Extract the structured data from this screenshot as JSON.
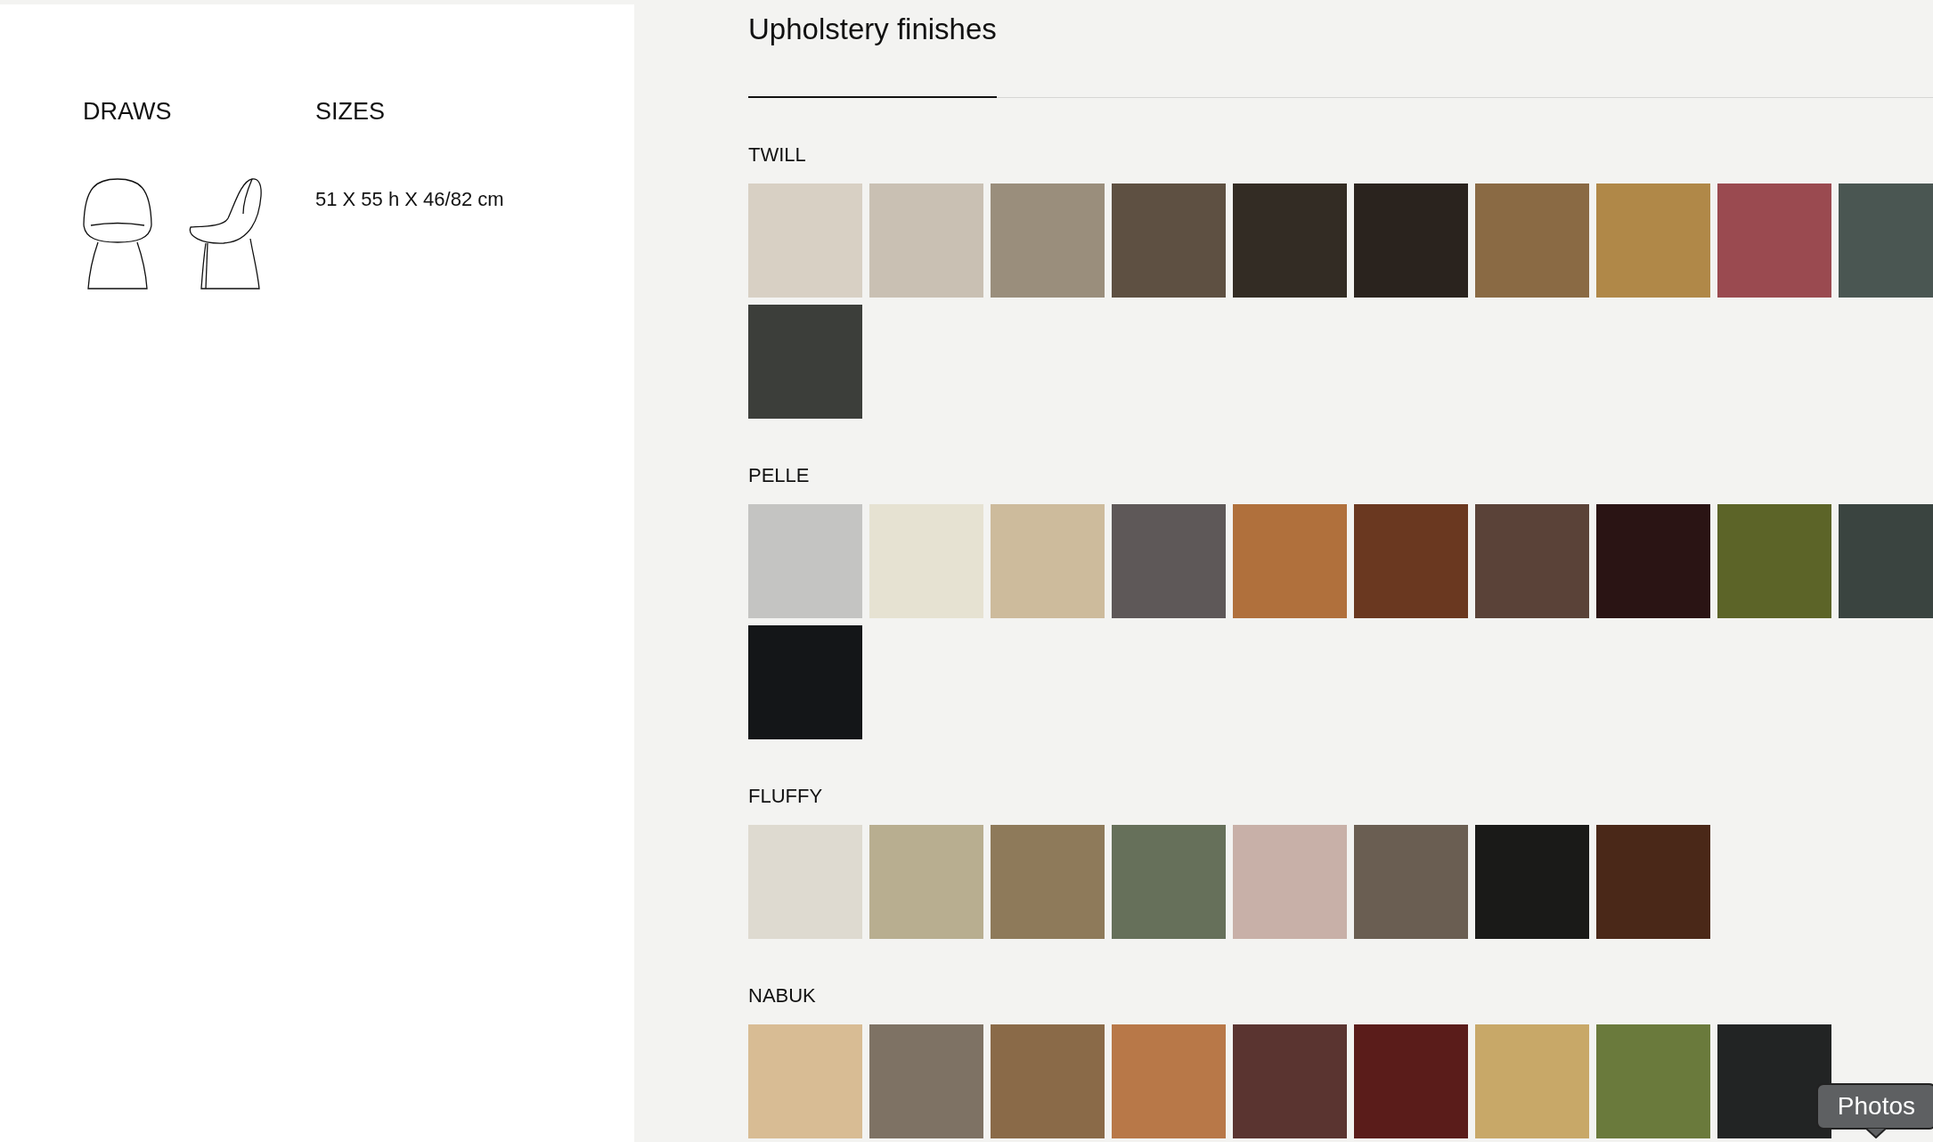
{
  "info": {
    "draws_heading": "DRAWS",
    "sizes_heading": "SIZES",
    "sizes_value": "51 X 55 h X 46/82 cm"
  },
  "finishes": {
    "title": "Upholstery finishes",
    "groups": [
      {
        "name": "TWILL",
        "swatches": [
          {
            "color": "#d8d0c4"
          },
          {
            "color": "#c9c0b3"
          },
          {
            "color": "#9a8e7c"
          },
          {
            "color": "#5e5042"
          },
          {
            "color": "#332c24"
          },
          {
            "color": "#2a231e"
          },
          {
            "color": "#8a6a44"
          },
          {
            "color": "#b08848"
          },
          {
            "color": "#9a4a50"
          },
          {
            "color": "#4a5652"
          },
          {
            "color": "#3c3e3a"
          }
        ]
      },
      {
        "name": "PELLE",
        "swatches": [
          {
            "color": "#c4c4c2"
          },
          {
            "color": "#e6e2d2"
          },
          {
            "color": "#cdbb9c"
          },
          {
            "color": "#5e5858"
          },
          {
            "color": "#b0703c"
          },
          {
            "color": "#6a3820"
          },
          {
            "color": "#5a4238"
          },
          {
            "color": "#2a1414"
          },
          {
            "color": "#5c6428"
          },
          {
            "color": "#3a4440"
          },
          {
            "color": "#141618"
          }
        ]
      },
      {
        "name": "FLUFFY",
        "swatches": [
          {
            "color": "#dedad0"
          },
          {
            "color": "#b8ae90"
          },
          {
            "color": "#8e7a5a"
          },
          {
            "color": "#66705a"
          },
          {
            "color": "#c8b0a8"
          },
          {
            "color": "#6a5e52"
          },
          {
            "color": "#1a1a18"
          },
          {
            "color": "#4a2818"
          }
        ]
      },
      {
        "name": "NABUK",
        "swatches": [
          {
            "color": "#d8bc94"
          },
          {
            "color": "#7e7264"
          },
          {
            "color": "#8a6a48"
          },
          {
            "color": "#b87848"
          },
          {
            "color": "#5a3430"
          },
          {
            "color": "#5a1c1a"
          },
          {
            "color": "#c8a868"
          },
          {
            "color": "#6a7a3c"
          },
          {
            "color": "#222424"
          }
        ]
      }
    ]
  },
  "tooltip": "Photos"
}
